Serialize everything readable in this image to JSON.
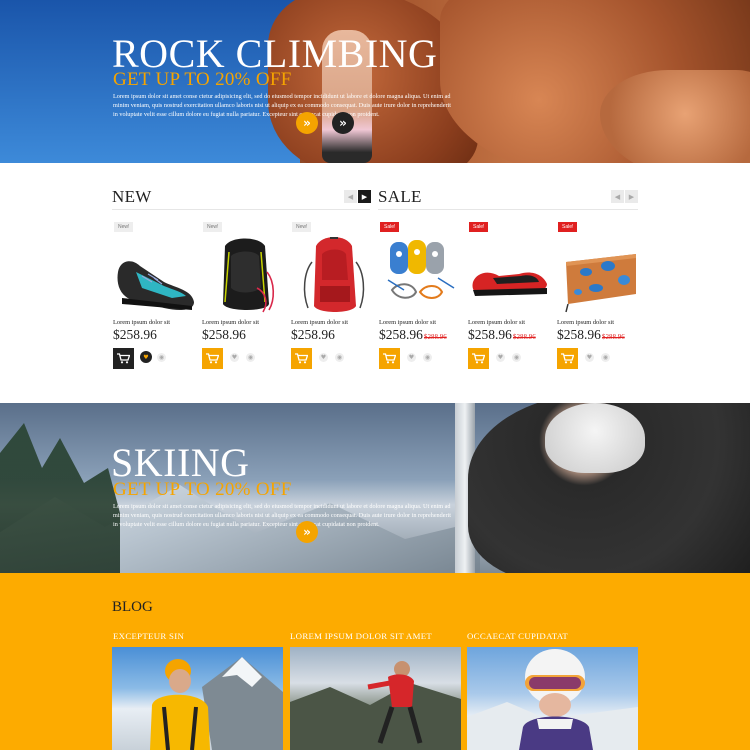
{
  "hero_climbing": {
    "title": "ROCK CLIMBING",
    "subtitle": "GET UP TO 20% OFF",
    "text": "Lorem ipsum dolor sit amet conse ctetur adipisicing elit, sed do eiusmod tempor incididunt ut labore et dolore magna aliqua. Ut enim ad minim veniam, quis nostrud exercitation ullamco laboris nisi ut aliquip ex ea commodo consequat. Duis aute irure dolor in reprehenderit in voluptate velit esse cillum dolore eu fugiat nulla pariatur. Excepteur sint occaecat cupidatat non proident.",
    "button_icon": "double-chevron-right-icon"
  },
  "new_section": {
    "title": "NEW"
  },
  "sale_section": {
    "title": "SALE"
  },
  "products": [
    {
      "badge": "New!",
      "name": "Lorem ipsum dolor sit",
      "price": "$258.96",
      "old_price": "",
      "image": "climbing-shoe"
    },
    {
      "badge": "New!",
      "name": "Lorem ipsum dolor sit",
      "price": "$258.96",
      "old_price": "",
      "image": "black-backpack"
    },
    {
      "badge": "New!",
      "name": "Lorem ipsum dolor sit",
      "price": "$258.96",
      "old_price": "",
      "image": "red-backpack"
    },
    {
      "badge": "Sale!",
      "name": "Lorem ipsum dolor sit",
      "price": "$258.96",
      "old_price": "$288.96",
      "image": "belay-devices"
    },
    {
      "badge": "Sale!",
      "name": "Lorem ipsum dolor sit",
      "price": "$258.96",
      "old_price": "$288.96",
      "image": "red-climbing-shoe"
    },
    {
      "badge": "Sale!",
      "name": "Lorem ipsum dolor sit",
      "price": "$258.96",
      "old_price": "$288.96",
      "image": "climbing-holds-board"
    }
  ],
  "hero_skiing": {
    "title": "SKIING",
    "subtitle": "GET UP TO 20% OFF",
    "text": "Lorem ipsum dolor sit amet conse ctetur adipisicing elit, sed do eiusmod tempor incididunt ut labore et dolore magna aliqua. Ut enim ad minim veniam, quis nostrud exercitation ullamco laboris nisi ut aliquip ex ea commodo consequat. Duis aute irure dolor in reprehenderit in voluptate velit esse cillum dolore eu fugiat nulla pariatur. Excepteur sint occaecat cupidatat non proident."
  },
  "blog": {
    "title": "BLOG",
    "posts": [
      {
        "title": "EXCEPTEUR SIN"
      },
      {
        "title": "LOREM IPSUM DOLOR SIT AMET"
      },
      {
        "title": "OCCAECAT CUPIDATAT"
      }
    ]
  },
  "colors": {
    "accent": "#fdab00",
    "sale": "#e02020",
    "dark": "#222222"
  }
}
